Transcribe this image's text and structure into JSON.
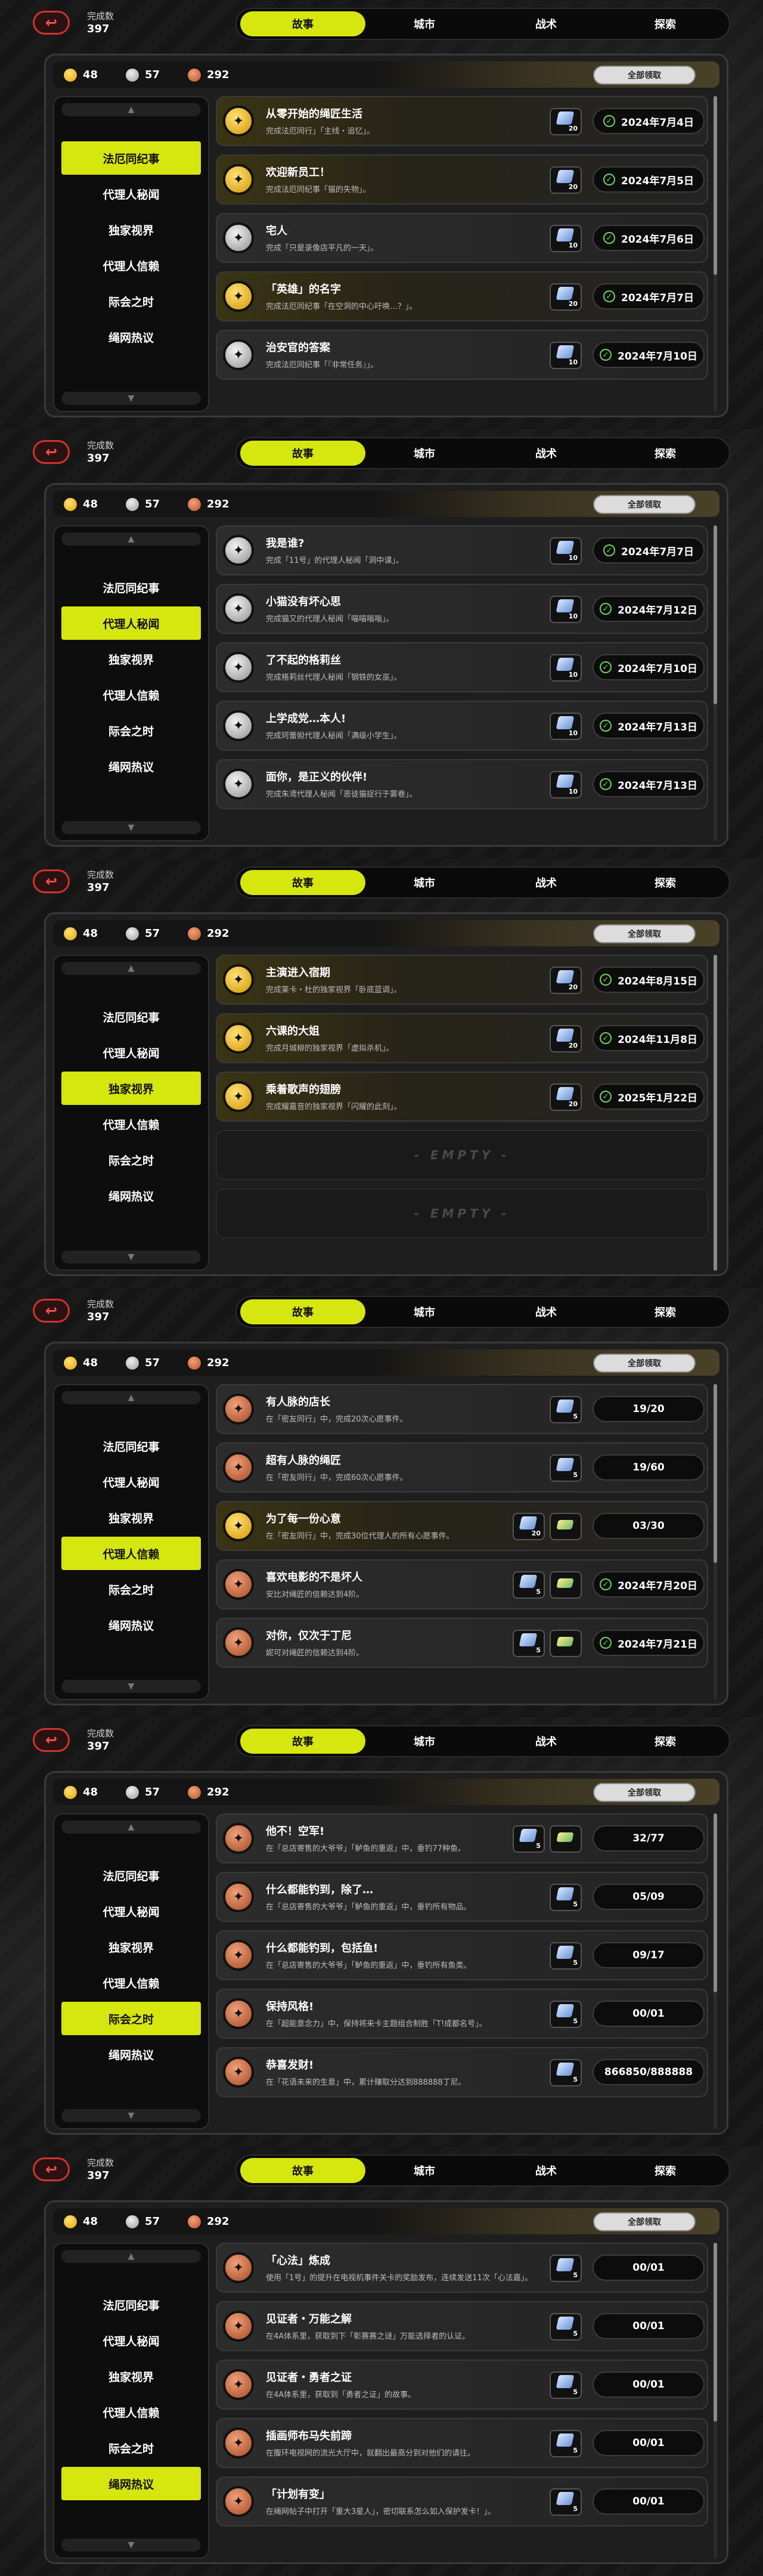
{
  "common": {
    "done_label": "完成数",
    "done_count": "397",
    "tabs": [
      "故事",
      "城市",
      "战术",
      "探索"
    ],
    "currency": [
      "48",
      "57",
      "292"
    ],
    "claim_all": "全部领取",
    "categories": [
      "法厄同纪事",
      "代理人秘闻",
      "独家视界",
      "代理人信赖",
      "际会之时",
      "绳网热议"
    ],
    "back_icon": "back-arrow-icon",
    "up_icon": "▲",
    "down_icon": "▼",
    "empty_text": "- EMPTY -"
  },
  "pages": [
    {
      "active_category": 0,
      "rows": [
        {
          "medal": "gold",
          "title": "从零开始的绳匠生活",
          "desc": "完成法厄同行」「主线・追忆」。",
          "rewards": [
            {
              "type": "gem",
              "qty": "20"
            }
          ],
          "status": "2024年7月4日",
          "done": true
        },
        {
          "medal": "gold",
          "title": "欢迎新员工！",
          "desc": "完成法厄同纪事「猫的失物」。",
          "rewards": [
            {
              "type": "gem",
              "qty": "20"
            }
          ],
          "status": "2024年7月5日",
          "done": true
        },
        {
          "medal": "silver",
          "title": "宅人",
          "desc": "完成「只是录像店平凡的一天」。",
          "rewards": [
            {
              "type": "gem",
              "qty": "10"
            }
          ],
          "status": "2024年7月6日",
          "done": true
        },
        {
          "medal": "gold",
          "title": "「英雄」的名字",
          "desc": "完成法厄同纪事「在空洞的中心吁唤…？」。",
          "rewards": [
            {
              "type": "gem",
              "qty": "20"
            }
          ],
          "status": "2024年7月7日",
          "done": true
        },
        {
          "medal": "silver",
          "title": "治安官的答案",
          "desc": "完成法厄同纪事「『非常任务』」。",
          "rewards": [
            {
              "type": "gem",
              "qty": "10"
            }
          ],
          "status": "2024年7月10日",
          "done": true
        }
      ]
    },
    {
      "active_category": 1,
      "rows": [
        {
          "medal": "silver",
          "title": "我是谁?",
          "desc": "完成「11号」的代理人秘闻「洞中课」。",
          "rewards": [
            {
              "type": "gem",
              "qty": "10"
            }
          ],
          "status": "2024年7月7日",
          "done": true
        },
        {
          "medal": "silver",
          "title": "小猫没有坏心思",
          "desc": "完成猫又的代理人秘闻「喵喵嗡嗡」。",
          "rewards": [
            {
              "type": "gem",
              "qty": "10"
            }
          ],
          "status": "2024年7月12日",
          "done": true
        },
        {
          "medal": "silver",
          "title": "了不起的格莉丝",
          "desc": "完成格莉丝代理人秘闻「钢铁的女巫」。",
          "rewards": [
            {
              "type": "gem",
              "qty": "10"
            }
          ],
          "status": "2024年7月10日",
          "done": true
        },
        {
          "medal": "silver",
          "title": "上学成党…本人!",
          "desc": "完成珂蕾妲代理人秘闻「满级小学生」。",
          "rewards": [
            {
              "type": "gem",
              "qty": "10"
            }
          ],
          "status": "2024年7月13日",
          "done": true
        },
        {
          "medal": "silver",
          "title": "面你，是正义的伙伴!",
          "desc": "完成朱鸢代理人秘闻「恶徒猫捉行于雾巷」。",
          "rewards": [
            {
              "type": "gem",
              "qty": "10"
            }
          ],
          "status": "2024年7月13日",
          "done": true
        }
      ]
    },
    {
      "active_category": 2,
      "rows": [
        {
          "medal": "gold",
          "title": "主演进入宿期",
          "desc": "完成莱卡・杜的独家视界「卧底蓝调」。",
          "rewards": [
            {
              "type": "gem",
              "qty": "20"
            }
          ],
          "status": "2024年8月15日",
          "done": true
        },
        {
          "medal": "gold",
          "title": "六课的大姐",
          "desc": "完成月城柳的独家视界「虚拟杀机」。",
          "rewards": [
            {
              "type": "gem",
              "qty": "20"
            }
          ],
          "status": "2024年11月8日",
          "done": true
        },
        {
          "medal": "gold",
          "title": "乘着歌声的翅膀",
          "desc": "完成耀嘉音的独家视界「闪耀的此刻」。",
          "rewards": [
            {
              "type": "gem",
              "qty": "20"
            }
          ],
          "status": "2025年1月22日",
          "done": true
        },
        {
          "empty": true
        },
        {
          "empty": true
        }
      ]
    },
    {
      "active_category": 3,
      "rows": [
        {
          "medal": "bronze",
          "title": "有人脉的店长",
          "desc": "在「密友同行」中，完成20次心愿事件。",
          "rewards": [
            {
              "type": "gem",
              "qty": "5"
            }
          ],
          "status": "19/20",
          "done": false
        },
        {
          "medal": "bronze",
          "title": "超有人脉的绳匠",
          "desc": "在「密友同行」中，完成60次心愿事件。",
          "rewards": [
            {
              "type": "gem",
              "qty": "5"
            }
          ],
          "status": "19/60",
          "done": false
        },
        {
          "medal": "gold",
          "title": "为了每一份心意",
          "desc": "在「密友同行」中，完成30位代理人的所有心愿事件。",
          "rewards": [
            {
              "type": "gem",
              "qty": "20"
            },
            {
              "type": "ticket",
              "qty": ""
            }
          ],
          "status": "03/30",
          "done": false
        },
        {
          "medal": "bronze",
          "title": "喜欢电影的不是坏人",
          "desc": "安比对绳匠的信赖达到4阶。",
          "rewards": [
            {
              "type": "gem",
              "qty": "5"
            },
            {
              "type": "ticket",
              "qty": ""
            }
          ],
          "status": "2024年7月20日",
          "done": true
        },
        {
          "medal": "bronze",
          "title": "对你，仅次于丁尼",
          "desc": "妮可对绳匠的信赖达到4阶。",
          "rewards": [
            {
              "type": "gem",
              "qty": "5"
            },
            {
              "type": "ticket",
              "qty": ""
            }
          ],
          "status": "2024年7月21日",
          "done": true
        }
      ]
    },
    {
      "active_category": 4,
      "rows": [
        {
          "medal": "bronze",
          "title": "他不！空军!",
          "desc": "在「总店寄售的大爷爷」「鲈鱼的重返」中，垂钓77种鱼。",
          "rewards": [
            {
              "type": "gem",
              "qty": "5"
            },
            {
              "type": "ticket",
              "qty": ""
            }
          ],
          "status": "32/77",
          "done": false
        },
        {
          "medal": "bronze",
          "title": "什么都能钓到，除了…",
          "desc": "在「总店寄售的大爷爷」「鲈鱼的重返」中，垂钓所有物品。",
          "rewards": [
            {
              "type": "gem",
              "qty": "5"
            }
          ],
          "status": "05/09",
          "done": false
        },
        {
          "medal": "bronze",
          "title": "什么都能钓到，包括鱼!",
          "desc": "在「总店寄售的大爷爷」「鲈鱼的重返」中，垂钓所有鱼类。",
          "rewards": [
            {
              "type": "gem",
              "qty": "5"
            }
          ],
          "status": "09/17",
          "done": false
        },
        {
          "medal": "bronze",
          "title": "保持风格!",
          "desc": "在「超能意念力」中，保持将来卡主题组合制胜「T!成都名号」。",
          "rewards": [
            {
              "type": "gem",
              "qty": "5"
            }
          ],
          "status": "00/01",
          "done": false
        },
        {
          "medal": "bronze",
          "title": "恭喜发财!",
          "desc": "在「花语未来的生意」中，累计赚取分达到888888丁尼。",
          "rewards": [
            {
              "type": "gem",
              "qty": "5"
            }
          ],
          "status": "866850/888888",
          "done": false
        }
      ]
    },
    {
      "active_category": 5,
      "rows": [
        {
          "medal": "bronze",
          "title": "「心法」炼成",
          "desc": "使用「1号」的提升在电视机事件关卡的奖励发布，连续发送11次「心法嘉」。",
          "rewards": [
            {
              "type": "gem",
              "qty": "5"
            }
          ],
          "status": "00/01",
          "done": false
        },
        {
          "medal": "bronze",
          "title": "见证者・万能之解",
          "desc": "在4A体系里，获取到下「彰赛赛之谜」万能选择者的认证。",
          "rewards": [
            {
              "type": "gem",
              "qty": "5"
            }
          ],
          "status": "00/01",
          "done": false
        },
        {
          "medal": "bronze",
          "title": "见证者・勇者之证",
          "desc": "在4A体系里，获取到「勇者之证」的故事。",
          "rewards": [
            {
              "type": "gem",
              "qty": "5"
            }
          ],
          "status": "00/01",
          "done": false
        },
        {
          "medal": "bronze",
          "title": "插画师布马失前蹄",
          "desc": "在腹环电视网的流光大厅中，就翻出最高分到对他们的请往。",
          "rewards": [
            {
              "type": "gem",
              "qty": "5"
            }
          ],
          "status": "00/01",
          "done": false
        },
        {
          "medal": "bronze",
          "title": "「计划有变」",
          "desc": "在绳网帖子中打开「重大3星人」，密切联系怎么如入保护发卡！」。",
          "rewards": [
            {
              "type": "gem",
              "qty": "5"
            }
          ],
          "status": "00/01",
          "done": false
        }
      ]
    }
  ]
}
